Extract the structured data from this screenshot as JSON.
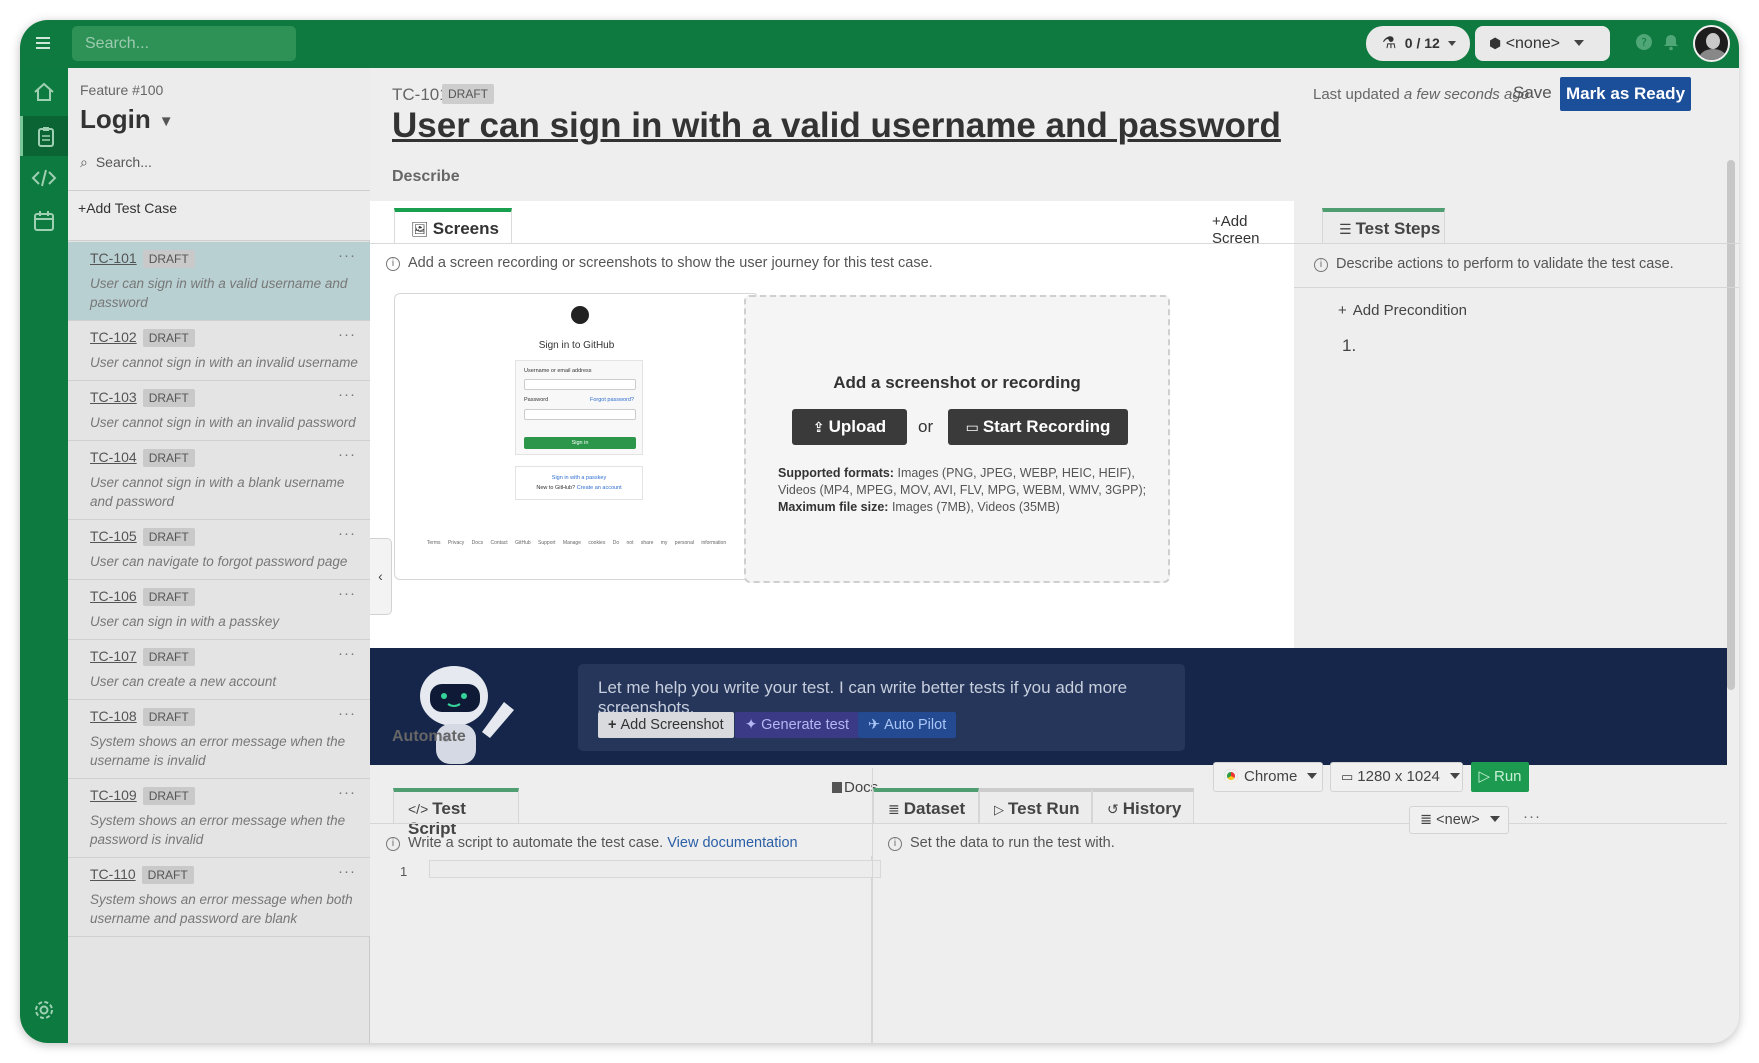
{
  "topbar": {
    "search_placeholder": "Search...",
    "flask_counter": "0 / 12",
    "environment": "<none>"
  },
  "feature": {
    "label": "Feature #100",
    "title": "Login",
    "search_placeholder": "Search...",
    "add_test_case": "Add Test Case",
    "test_cases": [
      {
        "id": "TC-101",
        "status": "DRAFT",
        "desc": "User can sign in with a valid username and password"
      },
      {
        "id": "TC-102",
        "status": "DRAFT",
        "desc": "User cannot sign in with an invalid username"
      },
      {
        "id": "TC-103",
        "status": "DRAFT",
        "desc": "User cannot sign in with an invalid password"
      },
      {
        "id": "TC-104",
        "status": "DRAFT",
        "desc": "User cannot sign in with a blank username and password"
      },
      {
        "id": "TC-105",
        "status": "DRAFT",
        "desc": "User can navigate to forgot password page"
      },
      {
        "id": "TC-106",
        "status": "DRAFT",
        "desc": "User can sign in with a passkey"
      },
      {
        "id": "TC-107",
        "status": "DRAFT",
        "desc": "User can create a new account"
      },
      {
        "id": "TC-108",
        "status": "DRAFT",
        "desc": "System shows an error message when the username is invalid"
      },
      {
        "id": "TC-109",
        "status": "DRAFT",
        "desc": "System shows an error message when the password is invalid"
      },
      {
        "id": "TC-110",
        "status": "DRAFT",
        "desc": "System shows an error message when both username and password are blank"
      }
    ]
  },
  "testcase": {
    "id": "TC-101",
    "status": "DRAFT",
    "title": "User can sign in with a valid username and password",
    "last_updated_prefix": "Last updated",
    "last_updated_when": "a few seconds ago",
    "save": "Save",
    "mark_ready": "Mark as Ready",
    "describe": "Describe"
  },
  "screens": {
    "tab": "Screens",
    "add_screen": "Add Screen",
    "info": "Add a screen recording or screenshots to show the user journey for this test case.",
    "thumb": {
      "title": "Sign in to GitHub",
      "username_label": "Username or email address",
      "password_label": "Password",
      "forgot": "Forgot password?",
      "signin": "Sign in",
      "passkey": "Sign in with a passkey",
      "new_prefix": "New to GitHub?",
      "create": "Create an account",
      "footer": "Terms Privacy Docs Contact GitHub Support Manage cookies Do not share my personal information"
    },
    "drop_title": "Add a screenshot or recording",
    "upload": "Upload",
    "or": "or",
    "start_recording": "Start Recording",
    "formats_label": "Supported formats:",
    "formats_value": "Images (PNG, JPEG, WEBP, HEIC, HEIF), Videos (MP4, MPEG, MOV, AVI, FLV, MPG, WEBM, WMV, 3GPP);",
    "max_label": "Maximum file size:",
    "max_value": "Images (7MB), Videos (35MB)"
  },
  "steps": {
    "tab": "Test Steps",
    "info": "Describe actions to perform to validate the test case.",
    "add_precondition": "Add Precondition",
    "first_step_number": "1."
  },
  "assistant": {
    "message": "Let me help you write your test. I can write better tests if you add more screenshots.",
    "add_screenshot": "Add Screenshot",
    "generate": "Generate test",
    "autopilot": "Auto Pilot"
  },
  "automate": {
    "heading": "Automate",
    "script_tab": "Test Script",
    "docs": "Docs",
    "script_info": "Write a script to automate the test case.",
    "view_docs": "View documentation",
    "line1": "1",
    "dataset_tab": "Dataset",
    "testrun_tab": "Test Run",
    "history_tab": "History",
    "browser": "Chrome",
    "resolution": "1280 x 1024",
    "run": "Run",
    "dataset_info": "Set the data to run the test with.",
    "dataset_select": "<new>"
  },
  "colors": {
    "topbar": "#0e7a3f",
    "primary_button": "#1b4f9a",
    "run_button": "#1c9a4f",
    "banner": "#15264a"
  }
}
